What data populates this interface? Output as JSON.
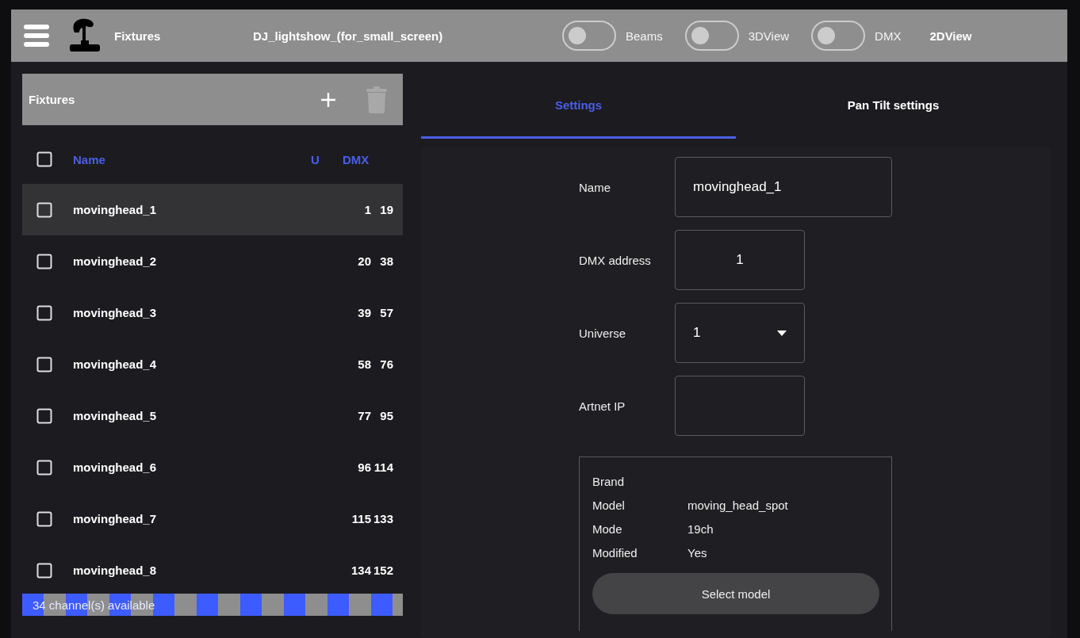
{
  "topbar": {
    "section": "Fixtures",
    "project": "DJ_lightshow_(for_small_screen)",
    "toggles": [
      {
        "label": "Beams",
        "on": false
      },
      {
        "label": "3DView",
        "on": false
      },
      {
        "label": "DMX",
        "on": false
      }
    ],
    "view": "2DView"
  },
  "fixtures": {
    "title": "Fixtures",
    "columns": [
      "Name",
      "U",
      "DMX"
    ],
    "header_checked": false,
    "rows": [
      {
        "name": "movinghead_1",
        "start": "1",
        "end": "19",
        "checked": false,
        "selected": true
      },
      {
        "name": "movinghead_2",
        "start": "20",
        "end": "38",
        "checked": false,
        "selected": false
      },
      {
        "name": "movinghead_3",
        "start": "39",
        "end": "57",
        "checked": false,
        "selected": false
      },
      {
        "name": "movinghead_4",
        "start": "58",
        "end": "76",
        "checked": false,
        "selected": false
      },
      {
        "name": "movinghead_5",
        "start": "77",
        "end": "95",
        "checked": false,
        "selected": false
      },
      {
        "name": "movinghead_6",
        "start": "96",
        "end": "114",
        "checked": false,
        "selected": false
      },
      {
        "name": "movinghead_7",
        "start": "115",
        "end": "133",
        "checked": false,
        "selected": false
      },
      {
        "name": "movinghead_8",
        "start": "134",
        "end": "152",
        "checked": false,
        "selected": false
      }
    ],
    "status": "34 channel(s) available"
  },
  "tabs": [
    {
      "label": "Settings",
      "selected": true
    },
    {
      "label": "Pan Tilt settings",
      "selected": false
    }
  ],
  "settings": {
    "fields": [
      {
        "label": "Name",
        "kind": "text",
        "value": "movinghead_1"
      },
      {
        "label": "DMX address",
        "kind": "number",
        "value": "1"
      },
      {
        "label": "Universe",
        "kind": "select",
        "value": "1"
      },
      {
        "label": "Artnet IP",
        "kind": "text"
      }
    ],
    "info": [
      {
        "label": "Brand"
      },
      {
        "label": "Model",
        "value": "moving_head_spot"
      },
      {
        "label": "Mode",
        "value": "19ch"
      },
      {
        "label": "Modified",
        "value": "Yes"
      }
    ],
    "button": "Select model"
  }
}
